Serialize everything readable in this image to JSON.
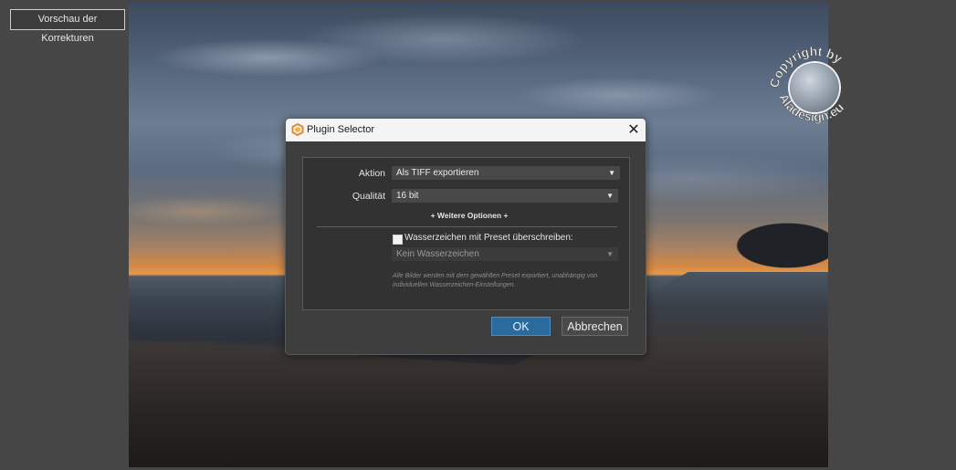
{
  "toolbar": {
    "preview_label": "Vorschau der Korrekturen"
  },
  "watermark": {
    "text": "Copyright by Aladesign.eu"
  },
  "dialog": {
    "title": "Plugin Selector",
    "close_icon": "close-icon",
    "action_label": "Aktion",
    "action_value": "Als TIFF exportieren",
    "quality_label": "Qualität",
    "quality_value": "16 bit",
    "more_options": "+ Weitere Optionen +",
    "watermark_checkbox_label": "Wasserzeichen mit Preset überschreiben:",
    "watermark_checked": false,
    "watermark_select_value": "Kein Wasserzeichen",
    "hint": "Alle Bilder werden mit dem gewählten Preset exportiert, unabhängig von individuellen Wasserzeichen-Einstellungen.",
    "ok_label": "OK",
    "cancel_label": "Abbrechen"
  },
  "colors": {
    "accent": "#2a6a9c",
    "dialog_bg": "#3e3e3e",
    "panel_bg": "#323232"
  }
}
